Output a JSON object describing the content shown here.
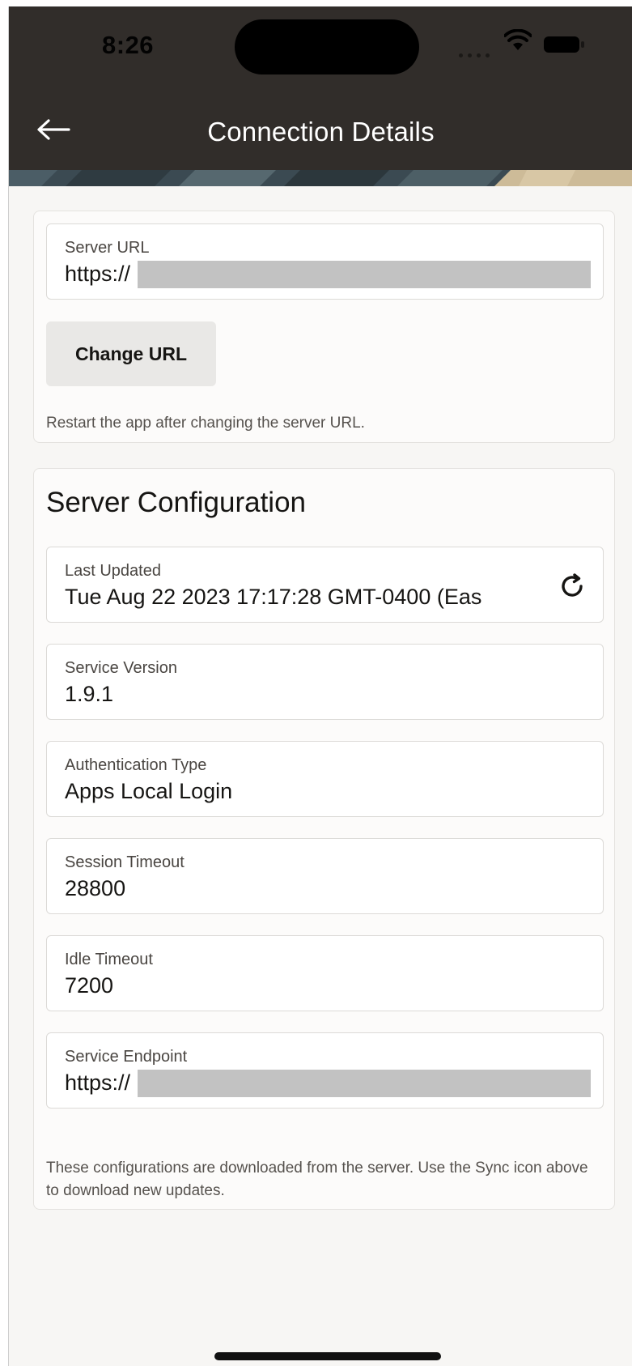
{
  "status_bar": {
    "time": "8:26"
  },
  "header": {
    "back_icon": "arrow-left-icon",
    "title": "Connection Details"
  },
  "server_url_card": {
    "label": "Server URL",
    "value": "https://",
    "change_url_label": "Change URL",
    "hint": "Restart the app after changing the server URL."
  },
  "server_config": {
    "title": "Server Configuration",
    "sync_icon": "sync-icon",
    "fields": [
      {
        "label": "Last Updated",
        "value": "Tue Aug 22 2023 17:17:28 GMT-0400 (Eas"
      },
      {
        "label": "Service Version",
        "value": "1.9.1"
      },
      {
        "label": "Authentication Type",
        "value": "Apps Local Login"
      },
      {
        "label": "Session Timeout",
        "value": "28800"
      },
      {
        "label": "Idle Timeout",
        "value": "7200"
      },
      {
        "label": "Service Endpoint",
        "value": "https://"
      }
    ],
    "hint": "These configurations are downloaded from the server. Use the Sync icon above to download new updates."
  },
  "colors": {
    "header_bg": "#312d2a",
    "page_bg": "#f7f6f4",
    "button_bg": "#e9e8e6"
  }
}
